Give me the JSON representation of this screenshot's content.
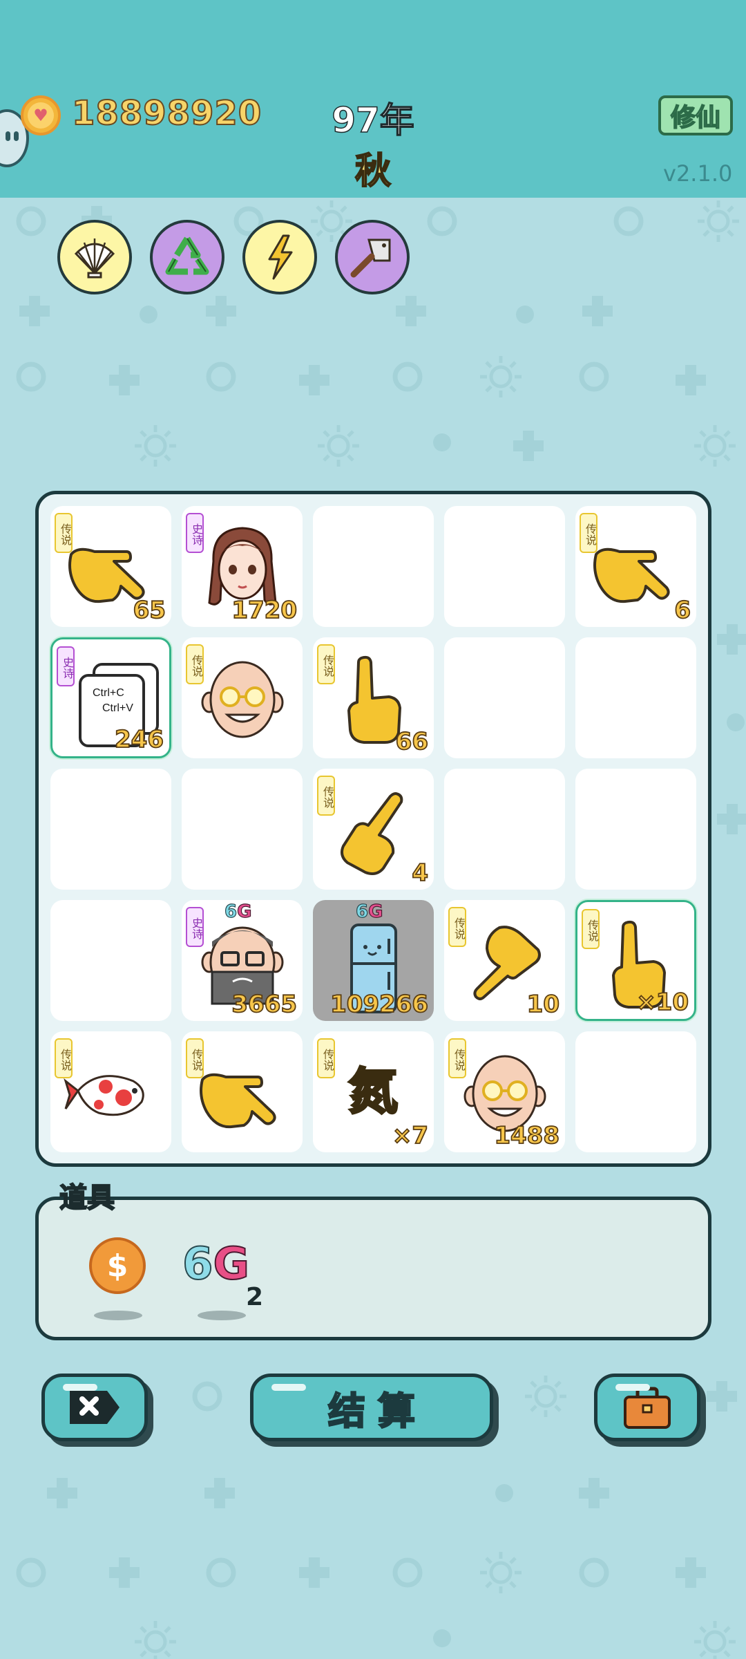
{
  "header": {
    "coin_icon": "heart-coin-icon",
    "coins": "18898920",
    "year": "97年",
    "season": "秋",
    "cultivate_label": "修仙",
    "version": "v2.1.0"
  },
  "tools": [
    {
      "name": "shell-icon",
      "bg": "#fdf6a6"
    },
    {
      "name": "recycle-icon",
      "bg": "#c49be6"
    },
    {
      "name": "lightning-icon",
      "bg": "#fdf6a6"
    },
    {
      "name": "cleaver-icon",
      "bg": "#c49be6"
    }
  ],
  "board": {
    "cells": [
      {
        "item": "pointing-hand",
        "rarity": "传说",
        "count": "65"
      },
      {
        "item": "girl-face",
        "rarity": "史诗",
        "count": "1720"
      },
      {
        "item": "",
        "rarity": "",
        "count": ""
      },
      {
        "item": "",
        "rarity": "",
        "count": ""
      },
      {
        "item": "pointing-hand",
        "rarity": "传说",
        "count": "6"
      },
      {
        "item": "copy-paste-card",
        "rarity": "史诗",
        "count": "246",
        "card_line1": "Ctrl+C",
        "card_line2": "Ctrl+V"
      },
      {
        "item": "old-man-glasses",
        "rarity": "传说",
        "count": ""
      },
      {
        "item": "finger-up-hand",
        "rarity": "传说",
        "count": "66"
      },
      {
        "item": "",
        "rarity": "",
        "count": ""
      },
      {
        "item": "",
        "rarity": "",
        "count": ""
      },
      {
        "item": "",
        "rarity": "",
        "count": ""
      },
      {
        "item": "",
        "rarity": "",
        "count": ""
      },
      {
        "item": "diagonal-point-hand",
        "rarity": "传说",
        "count": "4"
      },
      {
        "item": "",
        "rarity": "",
        "count": ""
      },
      {
        "item": "",
        "rarity": "",
        "count": ""
      },
      {
        "item": "",
        "rarity": "",
        "count": ""
      },
      {
        "item": "bearded-man-6g",
        "rarity": "史诗",
        "count": "3665",
        "tag": "6G"
      },
      {
        "item": "fridge-6g",
        "rarity": "",
        "count": "109266",
        "tag": "6G"
      },
      {
        "item": "down-point-hand",
        "rarity": "传说",
        "count": "10"
      },
      {
        "item": "finger-up-hand",
        "rarity": "传说",
        "count": "×10"
      },
      {
        "item": "koi-fish",
        "rarity": "传说",
        "count": ""
      },
      {
        "item": "pointing-hand",
        "rarity": "传说",
        "count": ""
      },
      {
        "item": "nitrogen-char",
        "rarity": "传说",
        "count": "×7",
        "glyph": "氮"
      },
      {
        "item": "old-man-glasses",
        "rarity": "传说",
        "count": "1488"
      },
      {
        "item": "",
        "rarity": "",
        "count": ""
      }
    ]
  },
  "props": {
    "label": "道具",
    "items": [
      {
        "name": "dollar-coin-icon",
        "symbol": "$"
      },
      {
        "name": "6g-icon",
        "six": "6",
        "g": "G",
        "qty": "2"
      }
    ]
  },
  "buttons": {
    "exit_icon": "close-icon",
    "settle_label": "结算",
    "bag_icon": "briefcase-icon"
  },
  "colors": {
    "header": "#5ec4c6",
    "background": "#b3dde3",
    "coin_text": "#f7d469",
    "legend_badge": "#e8c630",
    "epic_badge": "#b44fd3"
  }
}
